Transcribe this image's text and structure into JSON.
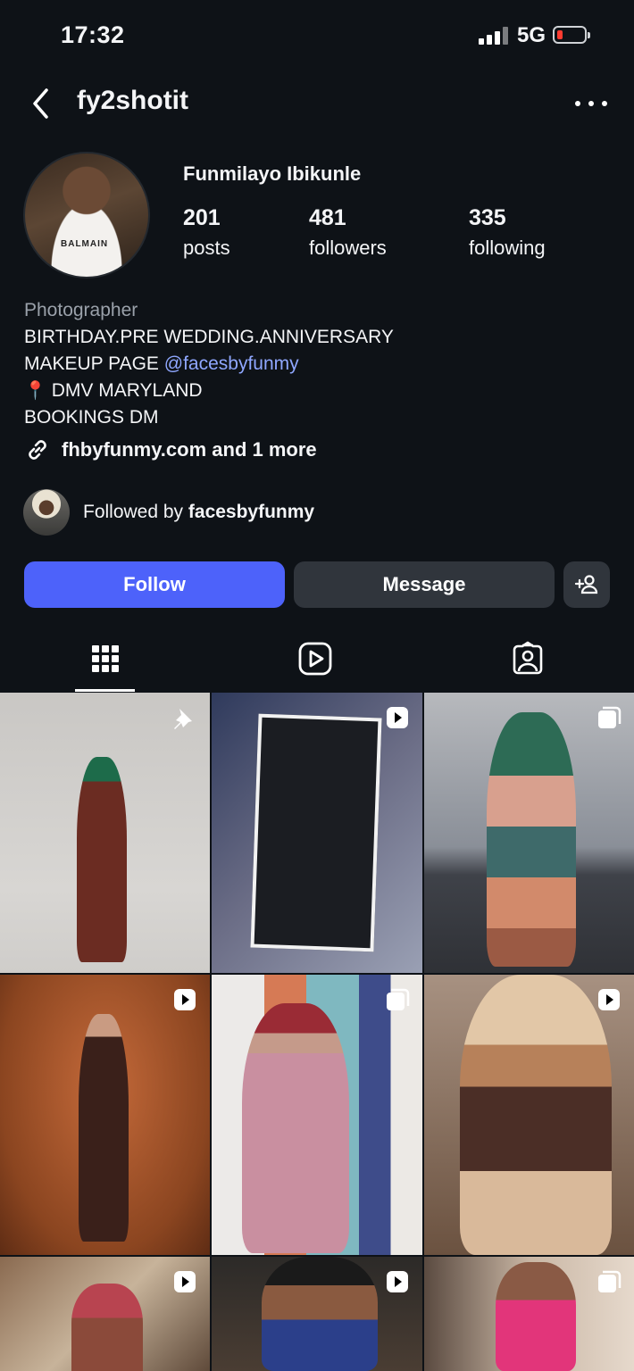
{
  "status": {
    "time": "17:32",
    "network": "5G"
  },
  "header": {
    "username": "fy2shotit"
  },
  "profile": {
    "full_name": "Funmilayo Ibikunle",
    "avatar_text": "BALMAIN",
    "stats": [
      {
        "value": "201",
        "label": "posts"
      },
      {
        "value": "481",
        "label": "followers"
      },
      {
        "value": "335",
        "label": "following"
      }
    ],
    "bio": {
      "category": "Photographer",
      "line1": "BIRTHDAY.PRE WEDDING.ANNIVERSARY",
      "line2_prefix": "MAKEUP PAGE ",
      "line2_mention": "@facesbyfunmy",
      "line3_pin": "📍",
      "line3": " DMV MARYLAND",
      "line4": "BOOKINGS DM"
    },
    "link": "fhbyfunmy.com and 1 more",
    "followed_by_prefix": "Followed by ",
    "followed_by_user": "facesbyfunmy"
  },
  "actions": {
    "follow": "Follow",
    "message": "Message"
  },
  "tabs": [
    "grid-icon",
    "reels-icon",
    "tagged-icon"
  ],
  "posts": [
    {
      "badge": "pin-icon"
    },
    {
      "badge": "reel-icon"
    },
    {
      "badge": "carousel-icon"
    },
    {
      "badge": "reel-icon"
    },
    {
      "badge": "carousel-icon"
    },
    {
      "badge": "reel-icon"
    },
    {
      "badge": "reel-icon"
    },
    {
      "badge": "reel-icon"
    },
    {
      "badge": "carousel-icon"
    }
  ]
}
